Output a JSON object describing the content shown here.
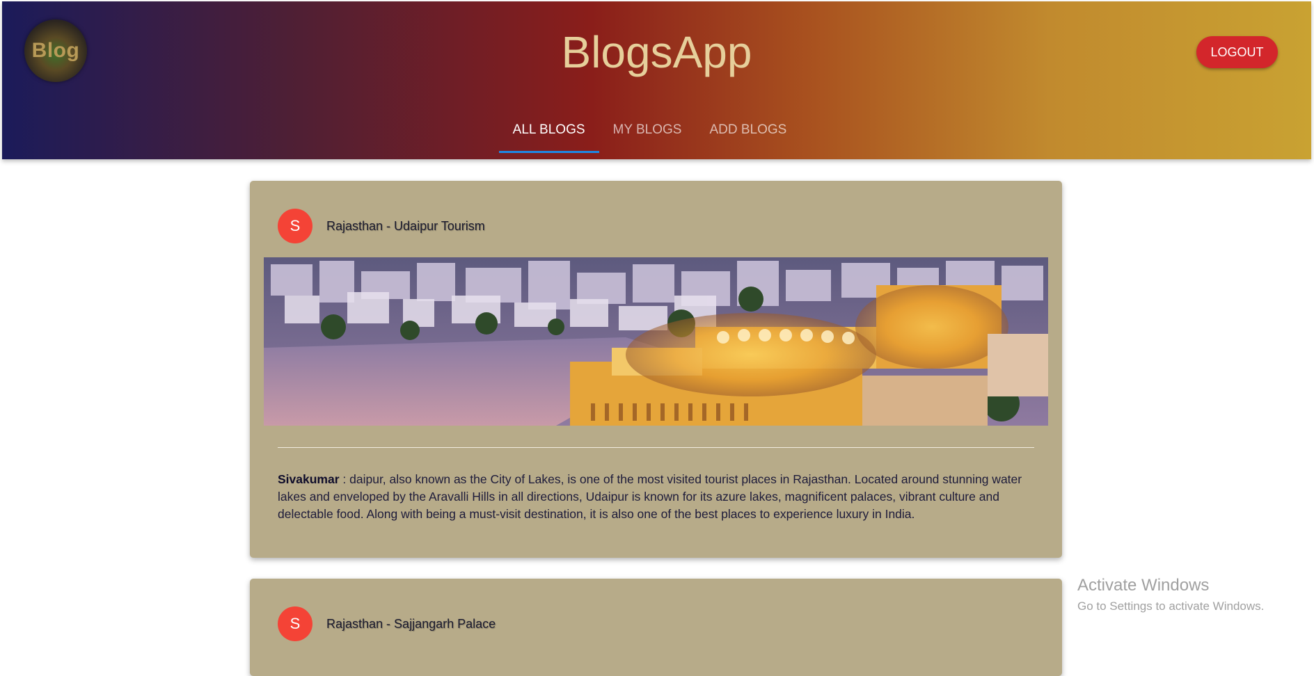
{
  "app": {
    "logo_text": "Blog",
    "title": "BlogsApp",
    "logout_label": "LOGOUT"
  },
  "tabs": [
    {
      "label": "ALL BLOGS",
      "active": true
    },
    {
      "label": "MY BLOGS",
      "active": false
    },
    {
      "label": "ADD BLOGS",
      "active": false
    }
  ],
  "posts": [
    {
      "avatar": "S",
      "title": "Rajasthan - Udaipur Tourism",
      "author": "Sivakumar",
      "separator": " : ",
      "description": "daipur, also known as the City of Lakes, is one of the most visited tourist places in Rajasthan. Located around stunning water lakes and enveloped by the Aravalli Hills in all directions, Udaipur is known for its azure lakes, magnificent palaces, vibrant culture and delectable food. Along with being a must-visit destination, it is also one of the best places to experience luxury in India."
    },
    {
      "avatar": "S",
      "title": "Rajasthan - Sajjangarh Palace"
    }
  ],
  "watermark": {
    "line1": "Activate Windows",
    "line2": "Go to Settings to activate Windows."
  },
  "colors": {
    "card": "#b7ab89",
    "avatar": "#f44336",
    "logout": "#d3262b",
    "tab_indicator": "#1e88e5"
  }
}
